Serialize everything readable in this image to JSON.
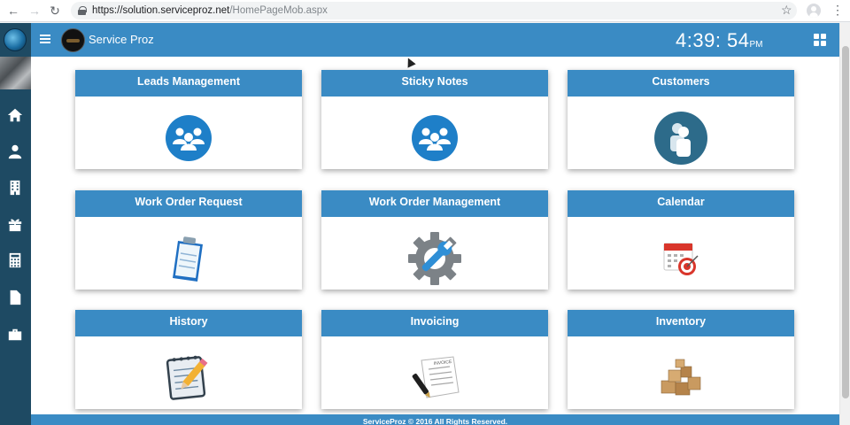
{
  "browser": {
    "url_host": "https://solution.serviceproz.net",
    "url_path": "/HomePageMob.aspx"
  },
  "header": {
    "brand": "Service Proz",
    "time": "4:39: 54",
    "ampm": "PM"
  },
  "sidebar": {
    "icons": [
      "home-icon",
      "user-icon",
      "building-icon",
      "gift-icon",
      "calculator-icon",
      "document-icon",
      "briefcase-icon"
    ]
  },
  "tiles": [
    {
      "label": "Leads Management",
      "icon": "group-icon"
    },
    {
      "label": "Sticky Notes",
      "icon": "group-icon"
    },
    {
      "label": "Customers",
      "icon": "customers-icon"
    },
    {
      "label": "Work Order Request",
      "icon": "clipboard-icon"
    },
    {
      "label": "Work Order Management",
      "icon": "gear-wrench-icon"
    },
    {
      "label": "Calendar",
      "icon": "calendar-icon"
    },
    {
      "label": "History",
      "icon": "notepad-pencil-icon"
    },
    {
      "label": "Invoicing",
      "icon": "invoice-pen-icon"
    },
    {
      "label": "Inventory",
      "icon": "boxes-icon"
    }
  ],
  "footer": {
    "text": "ServiceProz © 2016 All Rights Reserved."
  },
  "colors": {
    "primary": "#3a8bc4",
    "sidebar": "#1e4a63"
  }
}
